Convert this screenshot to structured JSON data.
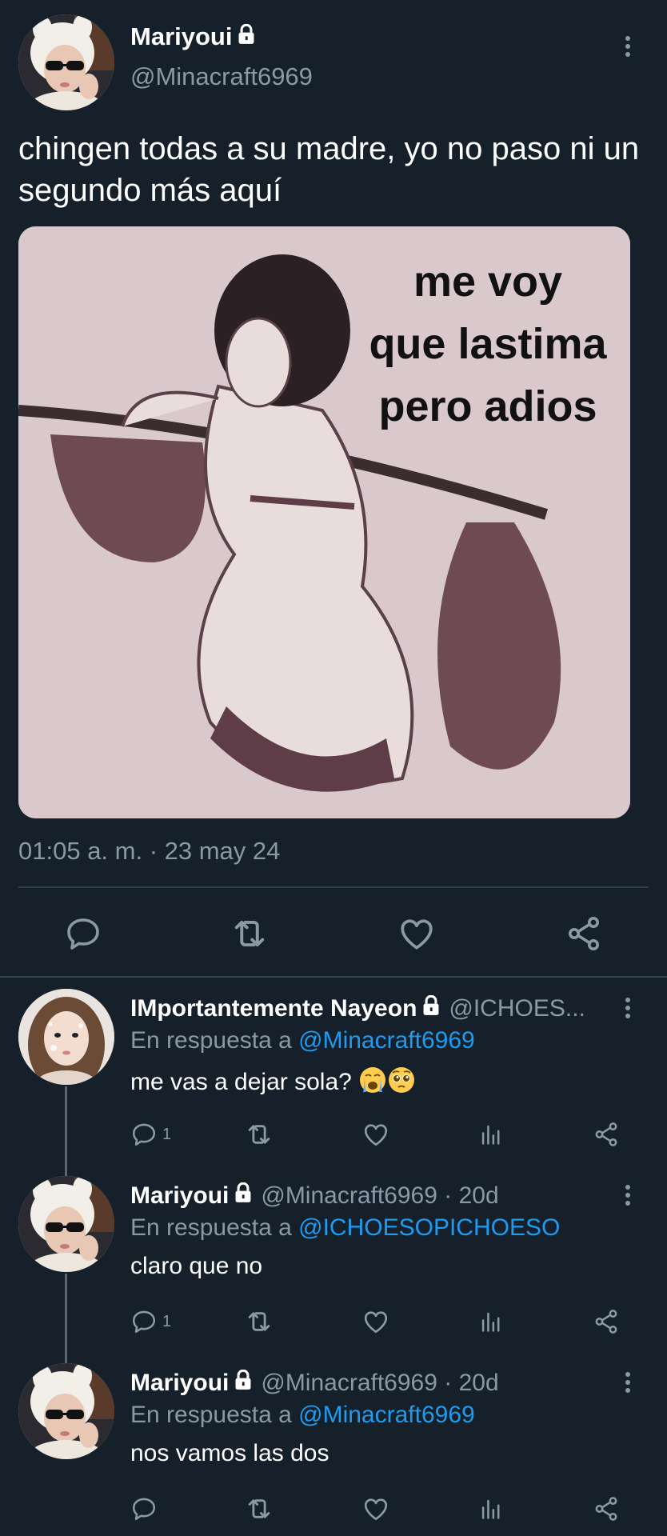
{
  "main_tweet": {
    "display_name": "Mariyoui",
    "handle": "@Minacraft6969",
    "text": "chingen todas a su madre, yo no paso ni un segundo más aquí",
    "media_caption_lines": [
      "me voy",
      "que lastima",
      "pero adios"
    ],
    "timestamp": "01:05 a. m. · 23 may 24",
    "icons": {
      "lock": "lock-icon",
      "more": "more-vertical-icon",
      "reply": "reply-icon",
      "retweet": "retweet-icon",
      "like": "heart-icon",
      "share": "share-icon"
    }
  },
  "replies": [
    {
      "display_name": "IMportantemente Nayeon",
      "handle": "@ICHOES...",
      "in_reply_prefix": "En respuesta a",
      "in_reply_to": "@Minacraft6969",
      "text": "me vas a dejar sola?",
      "emojis": [
        "loudly-crying-face",
        "pleading-face"
      ],
      "reply_count": "1"
    },
    {
      "display_name": "Mariyoui",
      "handle": "@Minacraft6969 · 20d",
      "in_reply_prefix": "En respuesta a",
      "in_reply_to": "@ICHOESOPICHOESO",
      "text": "claro que no",
      "reply_count": "1"
    },
    {
      "display_name": "Mariyoui",
      "handle": "@Minacraft6969 · 20d",
      "in_reply_prefix": "En respuesta a",
      "in_reply_to": "@Minacraft6969",
      "text": "nos vamos las dos",
      "reply_count": ""
    }
  ],
  "colors": {
    "background": "#15202b",
    "text_primary": "#ffffff",
    "text_secondary": "#8b98a5",
    "mention": "#1d9bf0",
    "divider": "#2f3b47"
  }
}
